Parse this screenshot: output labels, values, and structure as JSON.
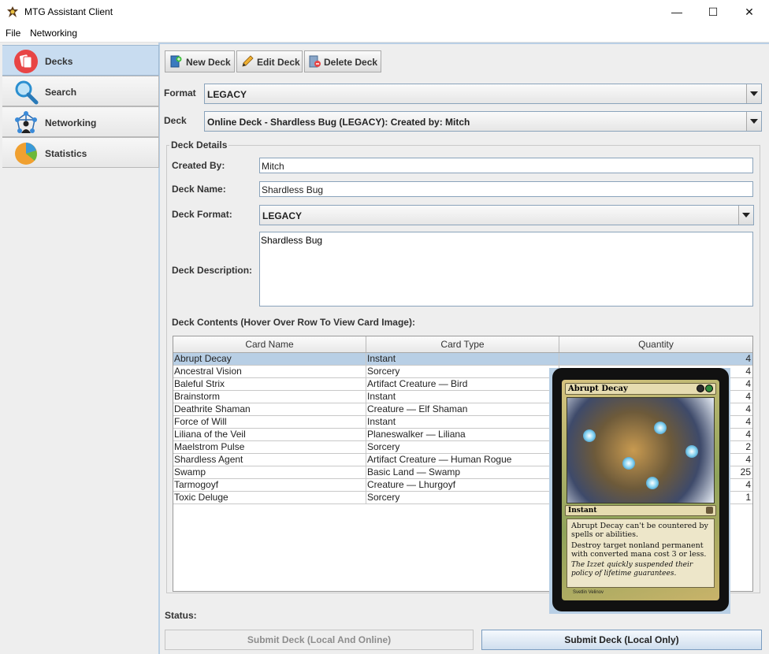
{
  "window": {
    "title": "MTG Assistant Client",
    "controls": {
      "minimize": "—",
      "maximize": "☐",
      "close": "✕"
    }
  },
  "menubar": {
    "items": [
      "File",
      "Networking"
    ]
  },
  "sidebar": {
    "items": [
      {
        "label": "Decks",
        "icon": "decks-icon",
        "active": true
      },
      {
        "label": "Search",
        "icon": "search-icon",
        "active": false
      },
      {
        "label": "Networking",
        "icon": "network-icon",
        "active": false
      },
      {
        "label": "Statistics",
        "icon": "pie-chart-icon",
        "active": false
      }
    ]
  },
  "toolbar": {
    "new_deck": "New Deck",
    "edit_deck": "Edit Deck",
    "delete_deck": "Delete Deck"
  },
  "selectors": {
    "format_label": "Format",
    "format_value": "LEGACY",
    "deck_label": "Deck",
    "deck_value": "Online Deck - Shardless Bug (LEGACY): Created by: Mitch"
  },
  "details": {
    "title": "Deck Details",
    "created_by_label": "Created By:",
    "created_by_value": "Mitch",
    "deck_name_label": "Deck Name:",
    "deck_name_value": "Shardless Bug",
    "deck_format_label": "Deck Format:",
    "deck_format_value": "LEGACY",
    "deck_description_label": "Deck Description:",
    "deck_description_value": "Shardless Bug",
    "contents_label": "Deck Contents (Hover Over Row To View Card Image):"
  },
  "table": {
    "headers": [
      "Card Name",
      "Card Type",
      "Quantity"
    ],
    "rows": [
      {
        "name": "Abrupt Decay",
        "type": "Instant",
        "qty": "4",
        "selected": true
      },
      {
        "name": "Ancestral Vision",
        "type": "Sorcery",
        "qty": "4"
      },
      {
        "name": "Baleful Strix",
        "type": "Artifact Creature — Bird",
        "qty": "4"
      },
      {
        "name": "Brainstorm",
        "type": "Instant",
        "qty": "4"
      },
      {
        "name": "Deathrite Shaman",
        "type": "Creature — Elf Shaman",
        "qty": "4"
      },
      {
        "name": "Force of Will",
        "type": "Instant",
        "qty": "4"
      },
      {
        "name": "Liliana of the Veil",
        "type": "Planeswalker — Liliana",
        "qty": "4"
      },
      {
        "name": "Maelstrom Pulse",
        "type": "Sorcery",
        "qty": "2"
      },
      {
        "name": "Shardless Agent",
        "type": "Artifact Creature — Human Rogue",
        "qty": "4"
      },
      {
        "name": "Swamp",
        "type": "Basic Land — Swamp",
        "qty": "25"
      },
      {
        "name": "Tarmogoyf",
        "type": "Creature — Lhurgoyf",
        "qty": "4"
      },
      {
        "name": "Toxic Deluge",
        "type": "Sorcery",
        "qty": "1"
      }
    ]
  },
  "card_preview": {
    "name": "Abrupt Decay",
    "type_line": "Instant",
    "rules_1": "Abrupt Decay can't be countered by spells or abilities.",
    "rules_2": "Destroy target nonland permanent with converted mana cost 3 or less.",
    "flavor": "The Izzet quickly suspended their policy of lifetime guarantees.",
    "artist": "Svetlin Velinov",
    "colors": {
      "black": "#2a2a2a",
      "green": "#2e8a3c"
    }
  },
  "footer": {
    "status_label": "Status:",
    "submit_online": "Submit Deck (Local And Online)",
    "submit_local": "Submit Deck (Local Only)"
  }
}
